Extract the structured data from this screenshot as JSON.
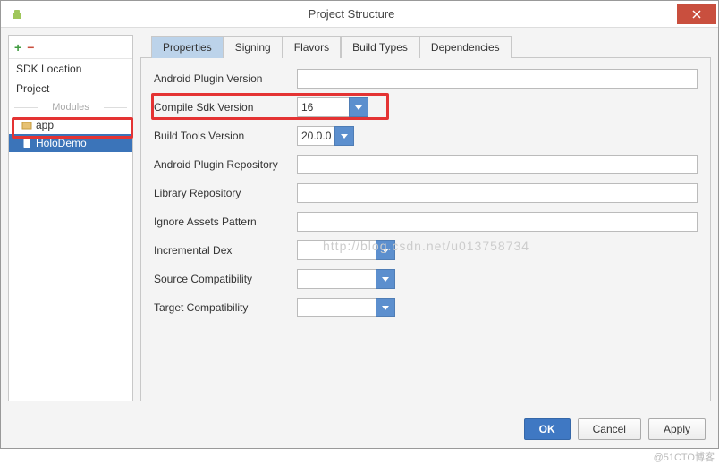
{
  "window": {
    "title": "Project Structure"
  },
  "sidebar": {
    "items": [
      {
        "label": "SDK Location"
      },
      {
        "label": "Project"
      }
    ],
    "modules_header": "Modules",
    "modules": [
      {
        "label": "app",
        "selected": false
      },
      {
        "label": "HoloDemo",
        "selected": true
      }
    ]
  },
  "tabs": [
    {
      "label": "Properties",
      "active": true
    },
    {
      "label": "Signing",
      "active": false
    },
    {
      "label": "Flavors",
      "active": false
    },
    {
      "label": "Build Types",
      "active": false
    },
    {
      "label": "Dependencies",
      "active": false
    }
  ],
  "form": {
    "android_plugin_version": {
      "label": "Android Plugin Version",
      "value": ""
    },
    "compile_sdk_version": {
      "label": "Compile Sdk Version",
      "value": "16"
    },
    "build_tools_version": {
      "label": "Build Tools Version",
      "value": "20.0.0"
    },
    "android_plugin_repository": {
      "label": "Android Plugin Repository",
      "value": ""
    },
    "library_repository": {
      "label": "Library Repository",
      "value": ""
    },
    "ignore_assets_pattern": {
      "label": "Ignore Assets Pattern",
      "value": ""
    },
    "incremental_dex": {
      "label": "Incremental Dex",
      "value": ""
    },
    "source_compatibility": {
      "label": "Source Compatibility",
      "value": ""
    },
    "target_compatibility": {
      "label": "Target Compatibility",
      "value": ""
    }
  },
  "footer": {
    "ok": "OK",
    "cancel": "Cancel",
    "apply": "Apply"
  },
  "watermark": "http://blog.csdn.net/u013758734",
  "credit": "@51CTO博客"
}
